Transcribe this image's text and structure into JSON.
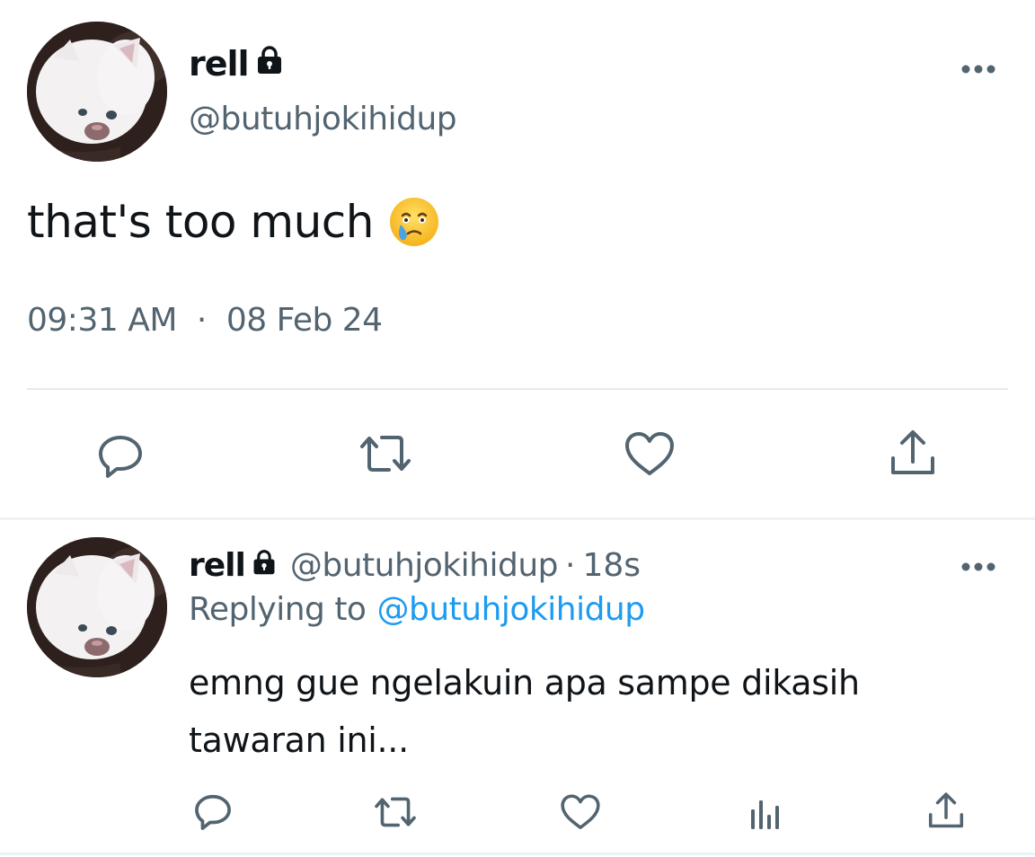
{
  "main_tweet": {
    "display_name": "rell",
    "handle": "@butuhjokihidup",
    "text": "that's too much",
    "emoji": "face-holding-back-tears",
    "time": "09:31 AM",
    "separator": "·",
    "date": "08 Feb 24"
  },
  "reply_tweet": {
    "display_name": "rell",
    "handle": "@butuhjokihidup",
    "separator": "·",
    "time": "18s",
    "replying_label": "Replying to",
    "replying_to": "@butuhjokihidup",
    "text": "emng gue ngelakuin apa sampe dikasih tawaran ini..."
  },
  "icons": {
    "protected": "lock-icon",
    "more": "more-icon",
    "reply": "reply-icon",
    "retweet": "retweet-icon",
    "like": "heart-icon",
    "views": "analytics-icon",
    "share": "share-icon"
  },
  "colors": {
    "text_primary": "#0f1419",
    "text_secondary": "#536471",
    "accent": "#1d9bf0",
    "divider": "#e6e9eb"
  }
}
